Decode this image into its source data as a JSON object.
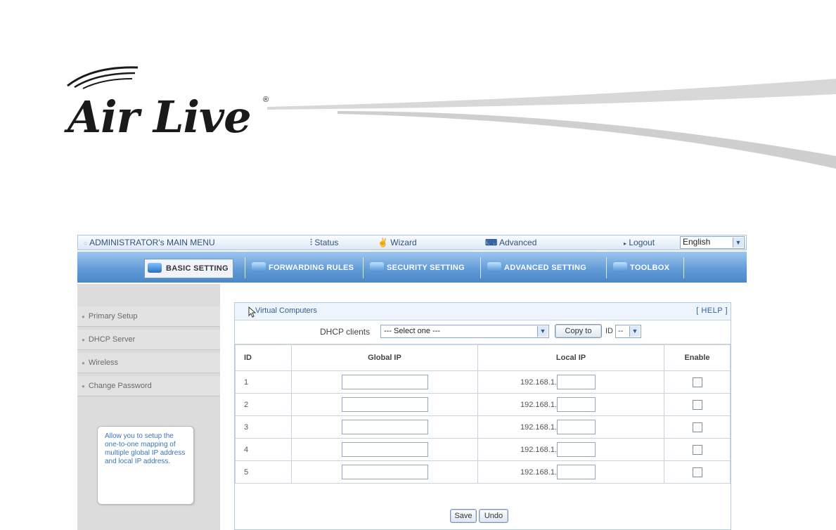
{
  "brand": {
    "logo_text": "Air Live",
    "registered_mark": "®"
  },
  "topbar": {
    "main_menu": "ADMINISTRATOR's MAIN MENU",
    "status": "Status",
    "wizard": "Wizard",
    "advanced": "Advanced",
    "logout": "Logout",
    "language": "English"
  },
  "tabs": [
    {
      "label": "BASIC SETTING",
      "active": true
    },
    {
      "label": "FORWARDING RULES",
      "active": false
    },
    {
      "label": "SECURITY SETTING",
      "active": false
    },
    {
      "label": "ADVANCED SETTING",
      "active": false
    },
    {
      "label": "TOOLBOX",
      "active": false
    }
  ],
  "sidebar": {
    "items": [
      {
        "label": "Primary Setup"
      },
      {
        "label": "DHCP Server"
      },
      {
        "label": "Wireless"
      },
      {
        "label": "Change Password"
      }
    ],
    "help_text": "Allow you to setup the one-to-one mapping of multiple global IP address and local IP address."
  },
  "content": {
    "title": "Virtual Computers",
    "help_link": "[ HELP ]",
    "dhcp_label": "DHCP clients",
    "dhcp_select": "--- Select one ---",
    "copy_button": "Copy to",
    "id_label": "ID",
    "id_select": "--",
    "columns": [
      "ID",
      "Global IP",
      "Local IP",
      "Enable"
    ],
    "rows": [
      {
        "id": "1",
        "global_ip": "",
        "local_prefix": "192.168.1.",
        "local_suffix": "",
        "enabled": false
      },
      {
        "id": "2",
        "global_ip": "",
        "local_prefix": "192.168.1.",
        "local_suffix": "",
        "enabled": false
      },
      {
        "id": "3",
        "global_ip": "",
        "local_prefix": "192.168.1.",
        "local_suffix": "",
        "enabled": false
      },
      {
        "id": "4",
        "global_ip": "",
        "local_prefix": "192.168.1.",
        "local_suffix": "",
        "enabled": false
      },
      {
        "id": "5",
        "global_ip": "",
        "local_prefix": "192.168.1.",
        "local_suffix": "",
        "enabled": false
      }
    ],
    "save_button": "Save",
    "undo_button": "Undo"
  }
}
